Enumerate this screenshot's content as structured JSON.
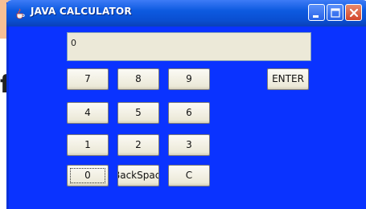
{
  "background": {
    "fragment_text": "fic"
  },
  "window": {
    "title": "JAVA CALCULATOR",
    "icon": "java-cup-icon",
    "controls": {
      "minimize_icon": "minimize-icon",
      "maximize_icon": "maximize-icon",
      "close_icon": "close-icon"
    },
    "background_color": "#0a33ff"
  },
  "display": {
    "value": "0"
  },
  "keys": {
    "k7": "7",
    "k8": "8",
    "k9": "9",
    "k4": "4",
    "k5": "5",
    "k6": "6",
    "k1": "1",
    "k2": "2",
    "k3": "3",
    "k0": "0",
    "backspace": "BackSpace",
    "clear": "C",
    "enter": "ENTER"
  }
}
